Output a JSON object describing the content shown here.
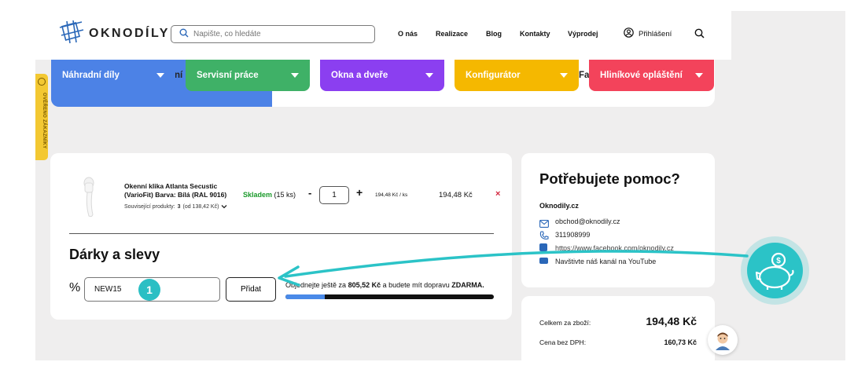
{
  "header": {
    "logo_text": "OKNODÍLY",
    "search_placeholder": "Napište, co hledáte",
    "nav": [
      "O nás",
      "Realizace",
      "Blog",
      "Kontakty",
      "Výprodej"
    ],
    "login_label": "Přihlášení"
  },
  "categories": [
    {
      "label": "Náhradní díly",
      "color": "#4c82e6"
    },
    {
      "label": "Servisní práce",
      "color": "#3fb167"
    },
    {
      "label": "Okna a dveře",
      "color": "#8b3ff0"
    },
    {
      "label": "Konfigurátor",
      "color": "#f5b800"
    },
    {
      "label": "Hliníkové opláštění",
      "color": "#f3435b"
    }
  ],
  "category_fragments": {
    "a": "ní",
    "b": "Fa"
  },
  "trust_badge": "OVĚŘENO ZÁKAZNÍKY",
  "cart": {
    "product_name_line1": "Okenní klika Atlanta Secustic",
    "product_name_line2": "(VarioFit) Barva: Bílá (RAL 9016)",
    "related_label": "Související produkty:",
    "related_count": "3",
    "related_price": "(od 138,42 Kč)",
    "stock_status": "Skladem",
    "stock_count": "(15 ks)",
    "qty_minus": "-",
    "quantity": "1",
    "qty_plus": "+",
    "unit_price": "194,48 Kč / ks",
    "line_total": "194,48 Kč",
    "remove": "×"
  },
  "discounts": {
    "title": "Dárky a slevy",
    "percent_symbol": "%",
    "coupon_value": "NEW15",
    "add_button": "Přidat",
    "shipping_text_1": "Objednejte ještě za",
    "shipping_amount": "805,52 Kč",
    "shipping_text_2": "a budete mít dopravu",
    "shipping_free": "ZDARMA.",
    "progress_fraction": 0.19,
    "step_badge": "1"
  },
  "help": {
    "title": "Potřebujete pomoc?",
    "site": "Oknodily.cz",
    "email": "obchod@oknodily.cz",
    "phone": "311908999",
    "facebook": "https://www.facebook.com/oknodily.cz",
    "youtube": "Navštivte náš kanál na YouTube"
  },
  "totals": {
    "goods_label": "Celkem za zboží:",
    "goods_value": "194,48 Kč",
    "novat_label": "Cena bez DPH:",
    "novat_value": "160,73 Kč"
  },
  "colors": {
    "accent_teal": "#2bc3c7",
    "in_stock_green": "#1a9a2a",
    "remove_red": "#d3273e"
  }
}
